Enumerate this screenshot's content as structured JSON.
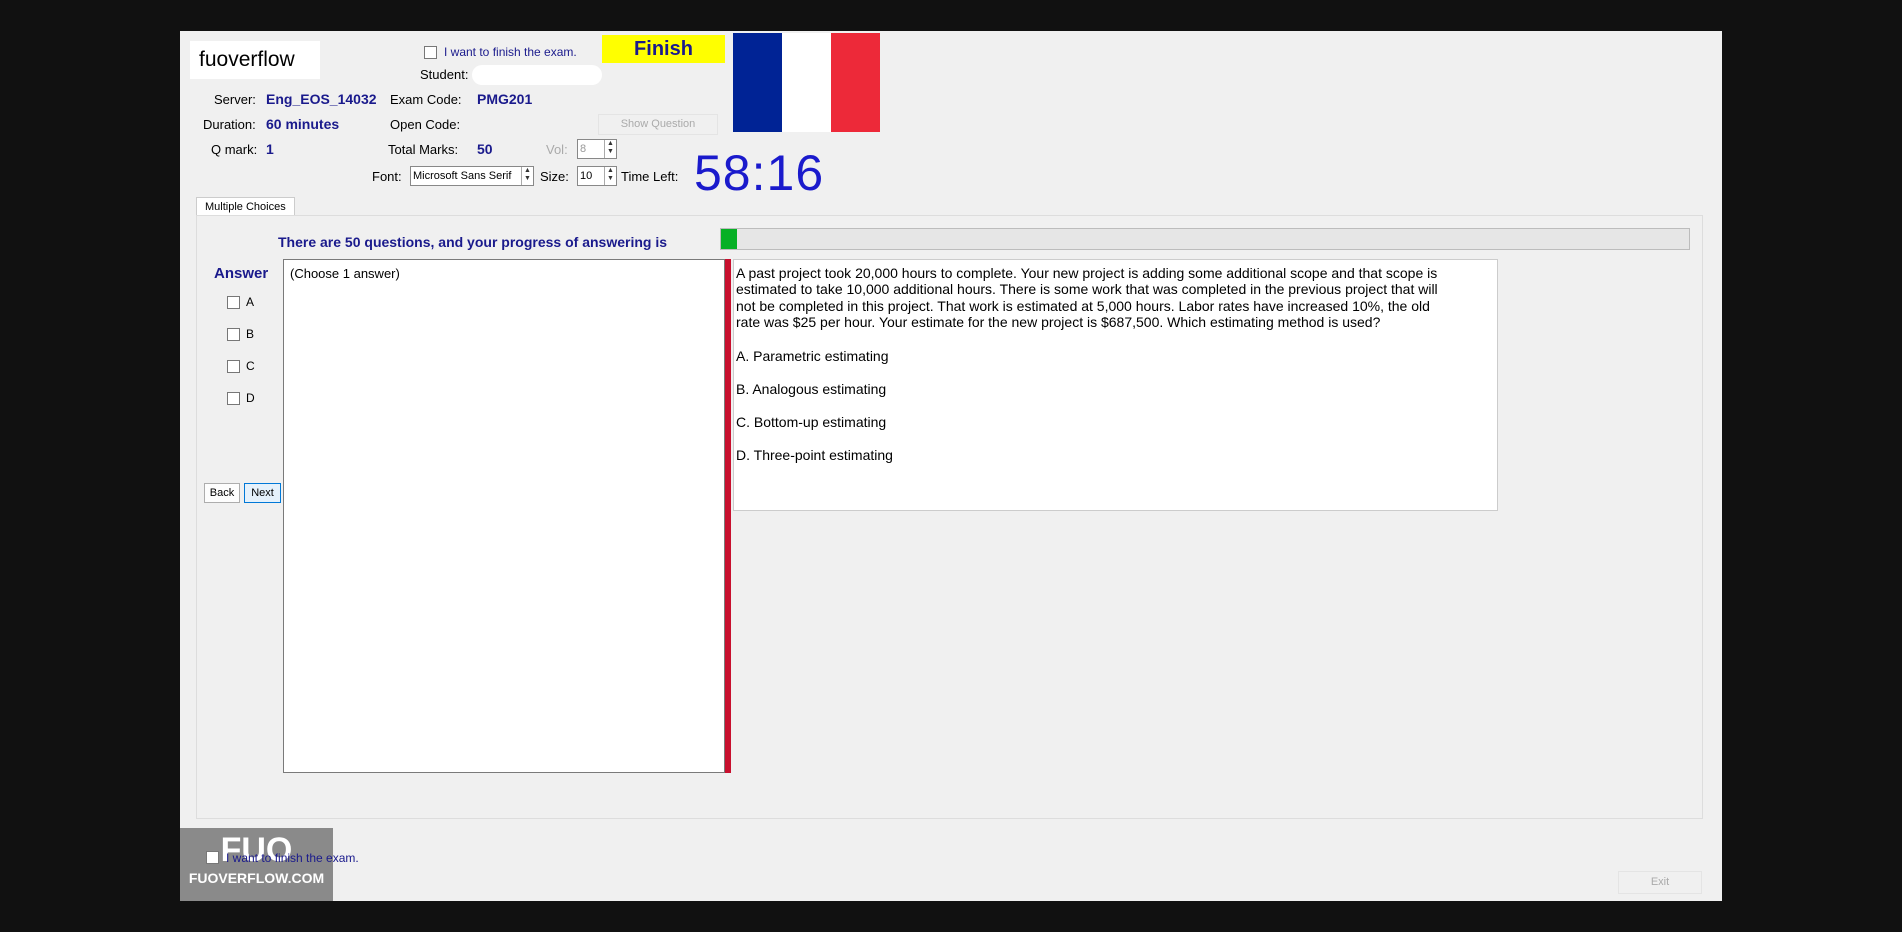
{
  "app": {
    "logo_text": "fuoverflow",
    "finish_checkbox_label": "I want to finish the exam.",
    "finish_button": "Finish",
    "flag_colors": [
      "#002395",
      "#ffffff",
      "#ed2939"
    ]
  },
  "info": {
    "student_label": "Student:",
    "student_value": "",
    "server_label": "Server:",
    "server_value": "Eng_EOS_14032",
    "exam_code_label": "Exam Code:",
    "exam_code_value": "PMG201",
    "duration_label": "Duration:",
    "duration_value": "60 minutes",
    "open_code_label": "Open Code:",
    "show_question_button": "Show Question",
    "qmark_label": "Q mark:",
    "qmark_value": "1",
    "total_marks_label": "Total Marks:",
    "total_marks_value": "50",
    "vol_label": "Vol:",
    "vol_value": "8",
    "font_label": "Font:",
    "font_value": "Microsoft Sans Serif",
    "size_label": "Size:",
    "size_value": "10",
    "time_left_label": "Time Left:",
    "time_left_value": "58:16"
  },
  "tabs": [
    "Multiple Choices"
  ],
  "progress": {
    "text": "There are 50 questions, and your progress of answering is",
    "value_fraction": 0.017,
    "color": "#06b025"
  },
  "answer": {
    "title": "Answer",
    "options": [
      "A",
      "B",
      "C",
      "D"
    ],
    "back_button": "Back",
    "next_button": "Next",
    "choose_text": "(Choose 1 answer)"
  },
  "question": {
    "text": "A past project took 20,000 hours to complete. Your new project is adding some additional scope and that scope is estimated to take 10,000 additional hours. There is some work that was completed in the previous project that will not be completed in this project. That work is estimated at 5,000 hours. Labor rates have increased 10%, the old rate was $25 per hour. Your estimate for the new project is $687,500. Which estimating method is used?",
    "options": [
      "A.  Parametric estimating",
      "B.  Analogous estimating",
      "C.  Bottom-up estimating",
      "D.  Three-point estimating"
    ]
  },
  "footer": {
    "finish_checkbox_label": "I want to finish the exam.",
    "logo_big": "FUO",
    "logo_small": "FUOVERFLOW.COM",
    "exit_button": "Exit"
  }
}
